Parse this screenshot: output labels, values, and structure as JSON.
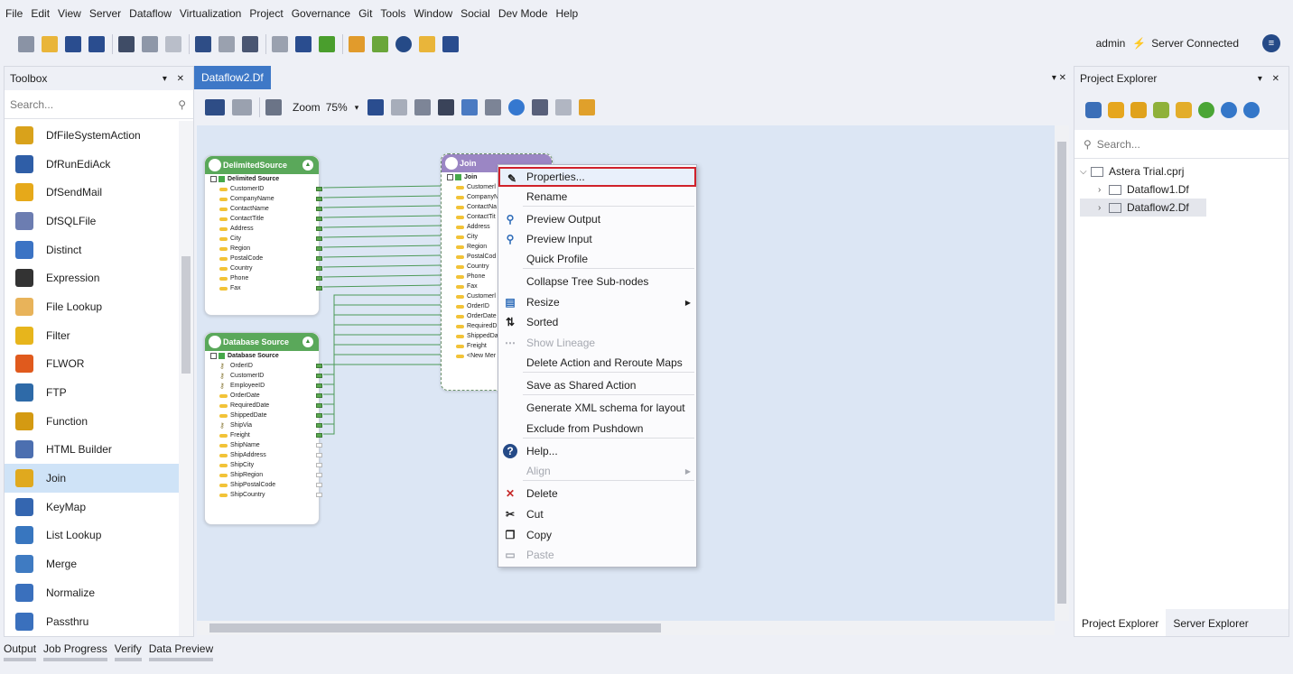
{
  "menu": [
    "File",
    "Edit",
    "View",
    "Server",
    "Dataflow",
    "Virtualization",
    "Project",
    "Governance",
    "Git",
    "Tools",
    "Window",
    "Social",
    "Dev Mode",
    "Help"
  ],
  "status": {
    "user": "admin",
    "connection": "Server Connected"
  },
  "toolbox": {
    "title": "Toolbox",
    "search_placeholder": "Search...",
    "items": [
      {
        "label": "DfFileSystemAction",
        "icon": "gears-icon",
        "color": "#d9a21b"
      },
      {
        "label": "DfRunEdiAck",
        "icon": "edi-icon",
        "color": "#2f5ea7"
      },
      {
        "label": "DfSendMail",
        "icon": "mail-icon",
        "color": "#e6a91a"
      },
      {
        "label": "DfSQLFile",
        "icon": "sql-file-icon",
        "color": "#6c7db1"
      },
      {
        "label": "Distinct",
        "icon": "distinct-icon",
        "color": "#3b73c4"
      },
      {
        "label": "Expression",
        "icon": "expression-icon",
        "color": "#333333"
      },
      {
        "label": "File Lookup",
        "icon": "file-lookup-icon",
        "color": "#e8b35a"
      },
      {
        "label": "Filter",
        "icon": "filter-icon",
        "color": "#e7b51c"
      },
      {
        "label": "FLWOR",
        "icon": "flwor-icon",
        "color": "#e05a1d"
      },
      {
        "label": "FTP",
        "icon": "ftp-icon",
        "color": "#2e6aa8"
      },
      {
        "label": "Function",
        "icon": "function-icon",
        "color": "#d49a12"
      },
      {
        "label": "HTML Builder",
        "icon": "html-builder-icon",
        "color": "#4c6fb0"
      },
      {
        "label": "Join",
        "icon": "join-icon",
        "color": "#e0a91e"
      },
      {
        "label": "KeyMap",
        "icon": "keymap-icon",
        "color": "#3466b0"
      },
      {
        "label": "List Lookup",
        "icon": "list-lookup-icon",
        "color": "#3876bf"
      },
      {
        "label": "Merge",
        "icon": "merge-icon",
        "color": "#3f7bc2"
      },
      {
        "label": "Normalize",
        "icon": "normalize-icon",
        "color": "#3a70bd"
      },
      {
        "label": "Passthru",
        "icon": "passthru-icon",
        "color": "#3a70bd"
      }
    ],
    "selected": "Join"
  },
  "document": {
    "tab": "Dataflow2.Df",
    "zoom_label": "Zoom",
    "zoom_value": "75%"
  },
  "nodes": {
    "delimited": {
      "title": "DelimitedSource",
      "root": "Delimited Source",
      "fields": [
        "CustomerID",
        "CompanyName",
        "ContactName",
        "ContactTitle",
        "Address",
        "City",
        "Region",
        "PostalCode",
        "Country",
        "Phone",
        "Fax"
      ],
      "color": "#5aa85a"
    },
    "database": {
      "title": "Database Source",
      "root": "Database Source",
      "fields": [
        "OrderID",
        "CustomerID",
        "EmployeeID",
        "OrderDate",
        "RequiredDate",
        "ShippedDate",
        "ShipVia",
        "Freight",
        "ShipName",
        "ShipAddress",
        "ShipCity",
        "ShipRegion",
        "ShipPostalCode",
        "ShipCountry"
      ],
      "key_fields": [
        "OrderID",
        "CustomerID",
        "EmployeeID",
        "ShipVia"
      ],
      "color": "#5aa85a"
    },
    "join": {
      "title": "Join",
      "root": "Join",
      "fields": [
        "Customerl",
        "CompanyNa",
        "ContactNa",
        "ContactTit",
        "Address",
        "City",
        "Region",
        "PostalCod",
        "Country",
        "Phone",
        "Fax",
        "Customerl",
        "OrderID",
        "OrderDate",
        "RequiredD",
        "ShippedDa",
        "Freight",
        "<New Mer"
      ],
      "color": "#9b86c4"
    }
  },
  "context_menu": {
    "items": [
      {
        "label": "Properties...",
        "icon": "properties-icon",
        "highlight": true
      },
      {
        "label": "Rename"
      },
      {
        "label": "Preview Output",
        "icon": "preview-output-icon"
      },
      {
        "label": "Preview Input",
        "icon": "preview-input-icon"
      },
      {
        "label": "Quick Profile"
      },
      {
        "label": "Collapse Tree Sub-nodes"
      },
      {
        "label": "Resize",
        "icon": "resize-icon",
        "submenu": true
      },
      {
        "label": "Sorted",
        "icon": "sort-icon"
      },
      {
        "label": "Show Lineage",
        "icon": "lineage-icon",
        "disabled": true
      },
      {
        "label": "Delete Action and Reroute Maps"
      },
      {
        "label": "Save as Shared Action"
      },
      {
        "label": "Generate XML schema for layout"
      },
      {
        "label": "Exclude from Pushdown"
      },
      {
        "label": "Help...",
        "icon": "help-icon"
      },
      {
        "label": "Align",
        "disabled": true,
        "submenu": true
      },
      {
        "label": "Delete",
        "icon": "delete-icon"
      },
      {
        "label": "Cut",
        "icon": "cut-icon"
      },
      {
        "label": "Copy",
        "icon": "copy-icon"
      },
      {
        "label": "Paste",
        "icon": "paste-icon",
        "disabled": true
      }
    ]
  },
  "project_explorer": {
    "title": "Project Explorer",
    "search_placeholder": "Search...",
    "tree": [
      {
        "label": "Astera Trial.cprj",
        "level": 0,
        "expanded": true
      },
      {
        "label": "Dataflow1.Df",
        "level": 1
      },
      {
        "label": "Dataflow2.Df",
        "level": 1,
        "selected": true
      }
    ],
    "bottom_tabs": [
      "Project Explorer",
      "Server Explorer"
    ]
  },
  "bottom_tabs": [
    "Output",
    "Job Progress",
    "Verify",
    "Data Preview"
  ]
}
